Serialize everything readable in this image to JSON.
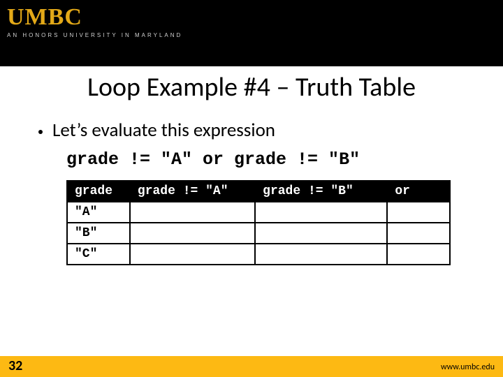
{
  "header": {
    "logo_main": "UMBC",
    "logo_sub": "AN HONORS UNIVERSITY IN MARYLAND"
  },
  "title": "Loop Example #4 – Truth Table",
  "bullet": "Let’s evaluate this expression",
  "expression": "grade != \"A\" or grade != \"B\"",
  "table": {
    "headers": [
      "grade",
      "grade != \"A\"",
      "grade != \"B\"",
      "or"
    ],
    "rows": [
      [
        "\"A\"",
        "",
        "",
        ""
      ],
      [
        "\"B\"",
        "",
        "",
        ""
      ],
      [
        "\"C\"",
        "",
        "",
        ""
      ]
    ]
  },
  "footer": {
    "page": "32",
    "url": "www.umbc.edu"
  },
  "chart_data": {
    "type": "table",
    "title": "Truth table for grade != \"A\" or grade != \"B\"",
    "columns": [
      "grade",
      "grade != \"A\"",
      "grade != \"B\"",
      "or"
    ],
    "rows": [
      {
        "grade": "\"A\"",
        "grade_ne_A": "",
        "grade_ne_B": "",
        "or": ""
      },
      {
        "grade": "\"B\"",
        "grade_ne_A": "",
        "grade_ne_B": "",
        "or": ""
      },
      {
        "grade": "\"C\"",
        "grade_ne_A": "",
        "grade_ne_B": "",
        "or": ""
      }
    ]
  }
}
